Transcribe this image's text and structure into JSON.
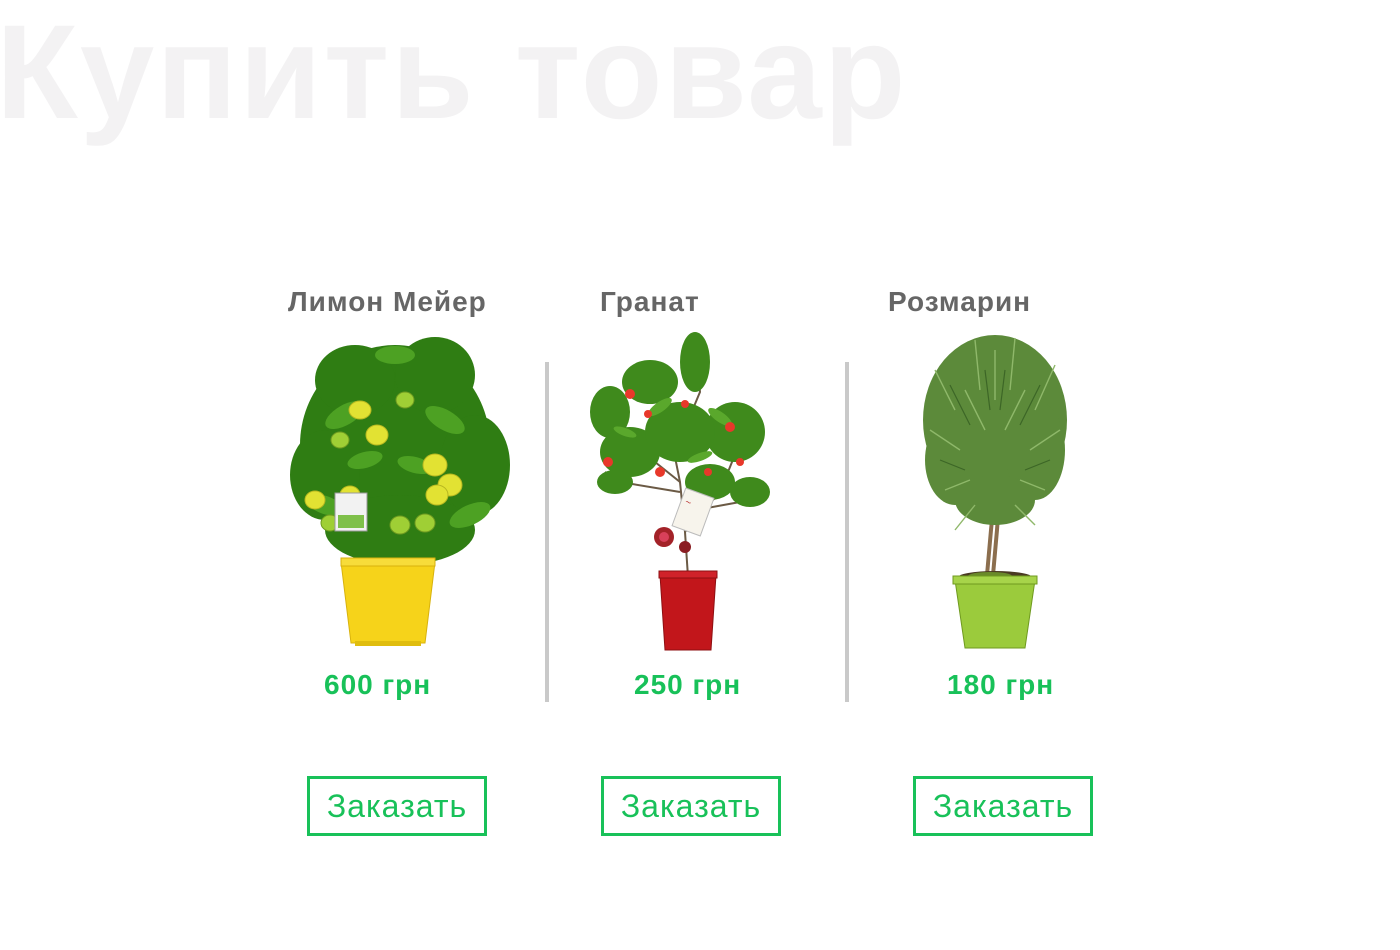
{
  "page": {
    "title": "Купить товар"
  },
  "products": [
    {
      "name": "Лимон Мейер",
      "price": "600 грн",
      "order_label": "Заказать",
      "pot_color": "#f6d31a",
      "image": "lemon-tree"
    },
    {
      "name": "Гранат",
      "price": "250 грн",
      "order_label": "Заказать",
      "pot_color": "#c2161b",
      "image": "pomegranate-tree"
    },
    {
      "name": "Розмарин",
      "price": "180 грн",
      "order_label": "Заказать",
      "pot_color": "#9bcb3c",
      "image": "rosemary-tree"
    }
  ],
  "colors": {
    "accent": "#18c159",
    "name_text": "#666666",
    "title_watermark": "#f3f2f3",
    "divider": "#c9c9c9"
  }
}
